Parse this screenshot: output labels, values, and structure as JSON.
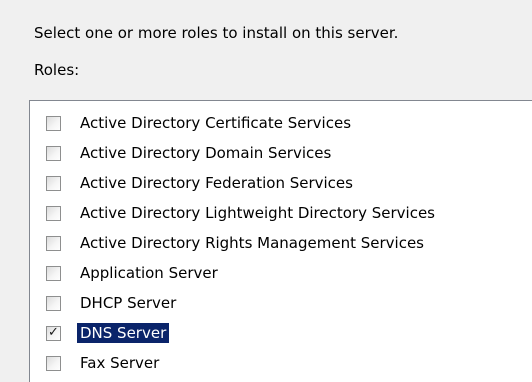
{
  "instruction": "Select one or more roles to install on this server.",
  "roles_label": "Roles:",
  "roles": [
    {
      "label": "Active Directory Certificate Services",
      "checked": false,
      "selected": false
    },
    {
      "label": "Active Directory Domain Services",
      "checked": false,
      "selected": false
    },
    {
      "label": "Active Directory Federation Services",
      "checked": false,
      "selected": false
    },
    {
      "label": "Active Directory Lightweight Directory Services",
      "checked": false,
      "selected": false
    },
    {
      "label": "Active Directory Rights Management Services",
      "checked": false,
      "selected": false
    },
    {
      "label": "Application Server",
      "checked": false,
      "selected": false
    },
    {
      "label": "DHCP Server",
      "checked": false,
      "selected": false
    },
    {
      "label": "DNS Server",
      "checked": true,
      "selected": true
    },
    {
      "label": "Fax Server",
      "checked": false,
      "selected": false
    }
  ],
  "colors": {
    "window_background": "#f0f0f0",
    "list_background": "#ffffff",
    "selection_background": "#0a246a",
    "selection_text": "#ffffff"
  },
  "icons": {
    "checkbox_checked": "check-mark-icon"
  }
}
